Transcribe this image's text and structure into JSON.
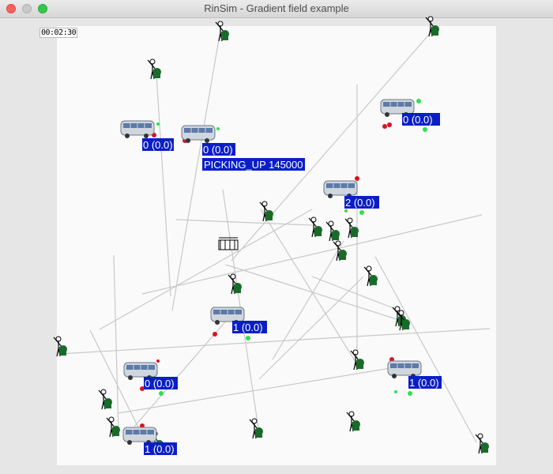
{
  "window": {
    "title": "RinSim - Gradient field example",
    "buttons": [
      "close",
      "minimize",
      "maximize"
    ]
  },
  "clock_text": "00:02:30",
  "colors": {
    "label_bg": "#0a1ec8",
    "label_text": "#ffffff",
    "road": "#c8c8c8",
    "parcel_pickup": "#e01020",
    "parcel_delivery": "#30e050",
    "passenger_body": "#1a6b2a"
  },
  "vehicles": [
    {
      "label": "0 (0.0)"
    },
    {
      "label": "0 (0.0)",
      "status": "PICKING_UP 145000"
    },
    {
      "label": "0 (0.0)"
    },
    {
      "label": "2 (0.0)"
    },
    {
      "label": "1 (0.0)"
    },
    {
      "label": "0 (0.0)"
    },
    {
      "label": "1 (0.0)"
    },
    {
      "label": "1 (0.0)"
    }
  ],
  "icons": {
    "passenger": "person-waving-icon",
    "vehicle": "taxi-van-icon",
    "depot": "depot-icon"
  }
}
